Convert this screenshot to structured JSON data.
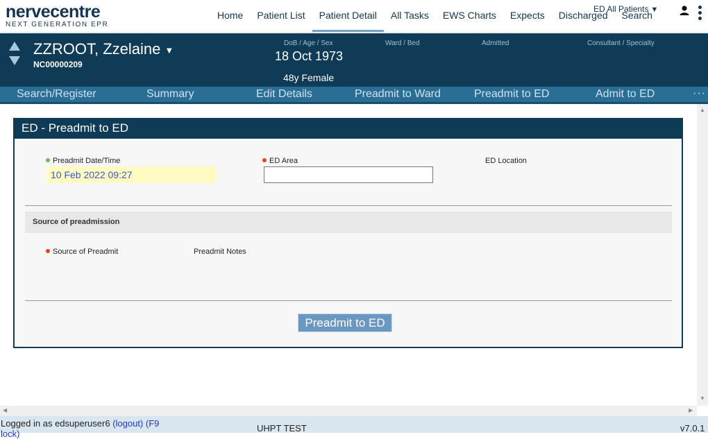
{
  "app": {
    "brand": "nervecentre",
    "tagline": "NEXT GENERATION EPR"
  },
  "nav": {
    "items": [
      "Home",
      "Patient List",
      "Patient Detail",
      "All Tasks",
      "EWS Charts",
      "Expects",
      "Discharged",
      "Search"
    ],
    "active": "Patient Detail",
    "ward_select": "ED All Patients"
  },
  "patient": {
    "name": "ZZROOT, Zzelaine",
    "number": "NC00000209",
    "dob_label": "DoB / Age / Sex",
    "dob": "18 Oct 1973",
    "age_sex": "48y Female",
    "ward_bed_label": "Ward / Bed",
    "admitted_label": "Admitted",
    "consultant_label": "Consultant / Specialty"
  },
  "subnav": {
    "items": [
      "Search/Register",
      "Summary",
      "Edit Details",
      "Preadmit to Ward",
      "Preadmit to ED",
      "Admit to ED"
    ],
    "more": "···"
  },
  "form": {
    "title": "ED - Preadmit to ED",
    "preadmit_datetime_label": "Preadmit Date/Time",
    "preadmit_datetime_value": "10 Feb 2022 09:27",
    "ed_area_label": "ED Area",
    "ed_area_value": "",
    "ed_location_label": "ED Location",
    "section_title": "Source of preadmission",
    "source_label": "Source of Preadmit",
    "notes_label": "Preadmit Notes",
    "submit_label": "Preadmit to ED",
    "colors": {
      "required": "#e6451c",
      "complete": "#6cc04a",
      "header": "#0f3b57"
    }
  },
  "footer": {
    "logged_in_text": "Logged in as edsuperuser6",
    "logout_label": "(logout)",
    "lock_label": "(F9",
    "lock_label2": "lock)",
    "environment": "UHPT TEST",
    "version": "v7.0.1"
  }
}
